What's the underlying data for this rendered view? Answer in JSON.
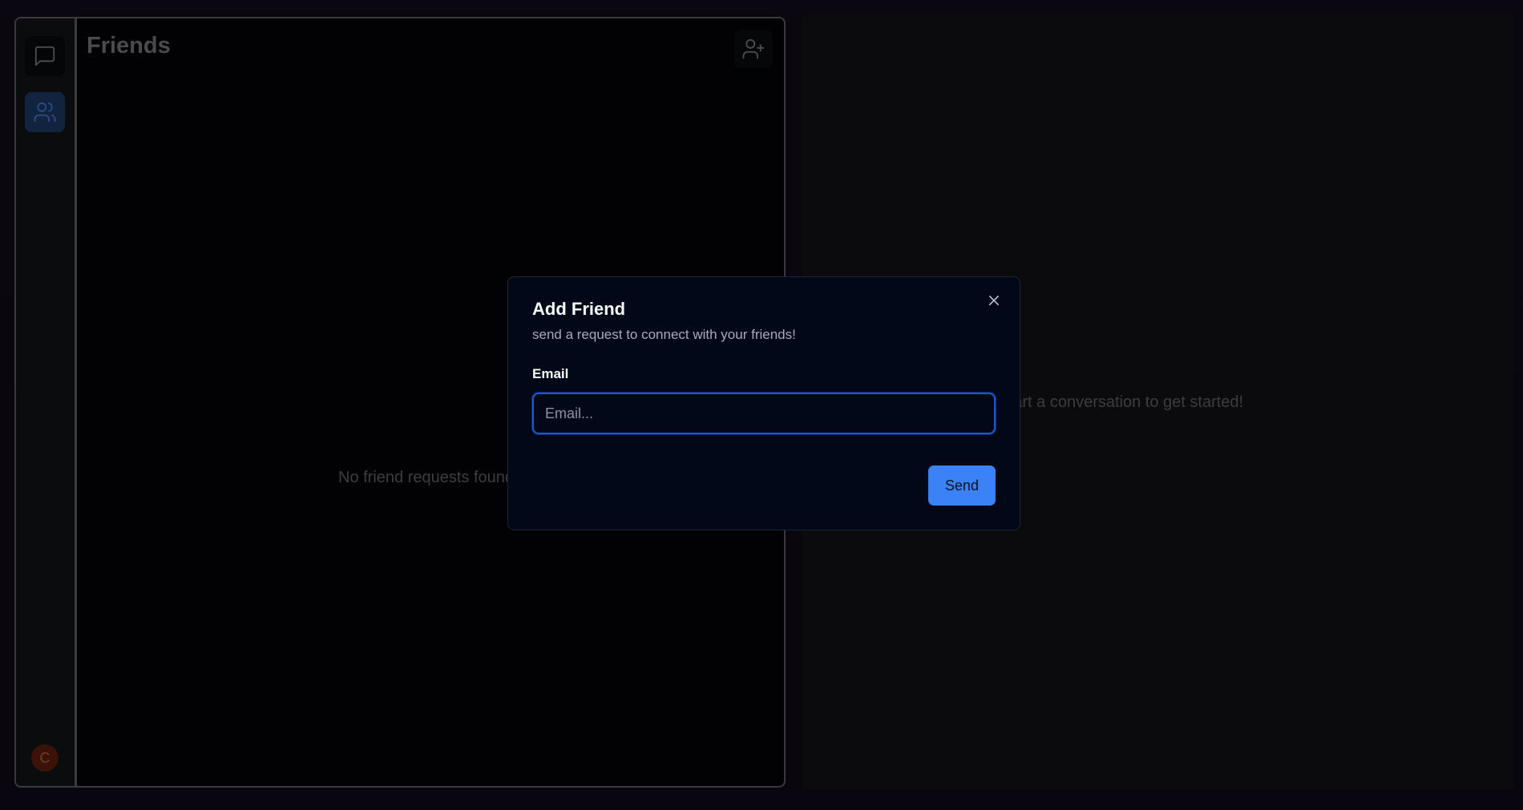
{
  "sidebar": {
    "items": [
      {
        "name": "chat",
        "icon": "message-square-icon",
        "active": false
      },
      {
        "name": "friends",
        "icon": "users-icon",
        "active": true
      }
    ],
    "avatar_initial": "C"
  },
  "friends_panel": {
    "title": "Friends",
    "add_friend_icon": "user-plus-icon",
    "empty_text": "No friend requests found"
  },
  "conversation": {
    "placeholder_text": "Select/ start a conversation to get started!"
  },
  "modal": {
    "title": "Add Friend",
    "subtitle": "send a request to connect with your friends!",
    "email_label": "Email",
    "email_placeholder": "Email...",
    "email_value": "",
    "send_label": "Send",
    "close_icon": "close-icon"
  },
  "colors": {
    "accent": "#3b82f6",
    "modal_bg": "#020817",
    "focus_ring": "#1e56d6"
  }
}
